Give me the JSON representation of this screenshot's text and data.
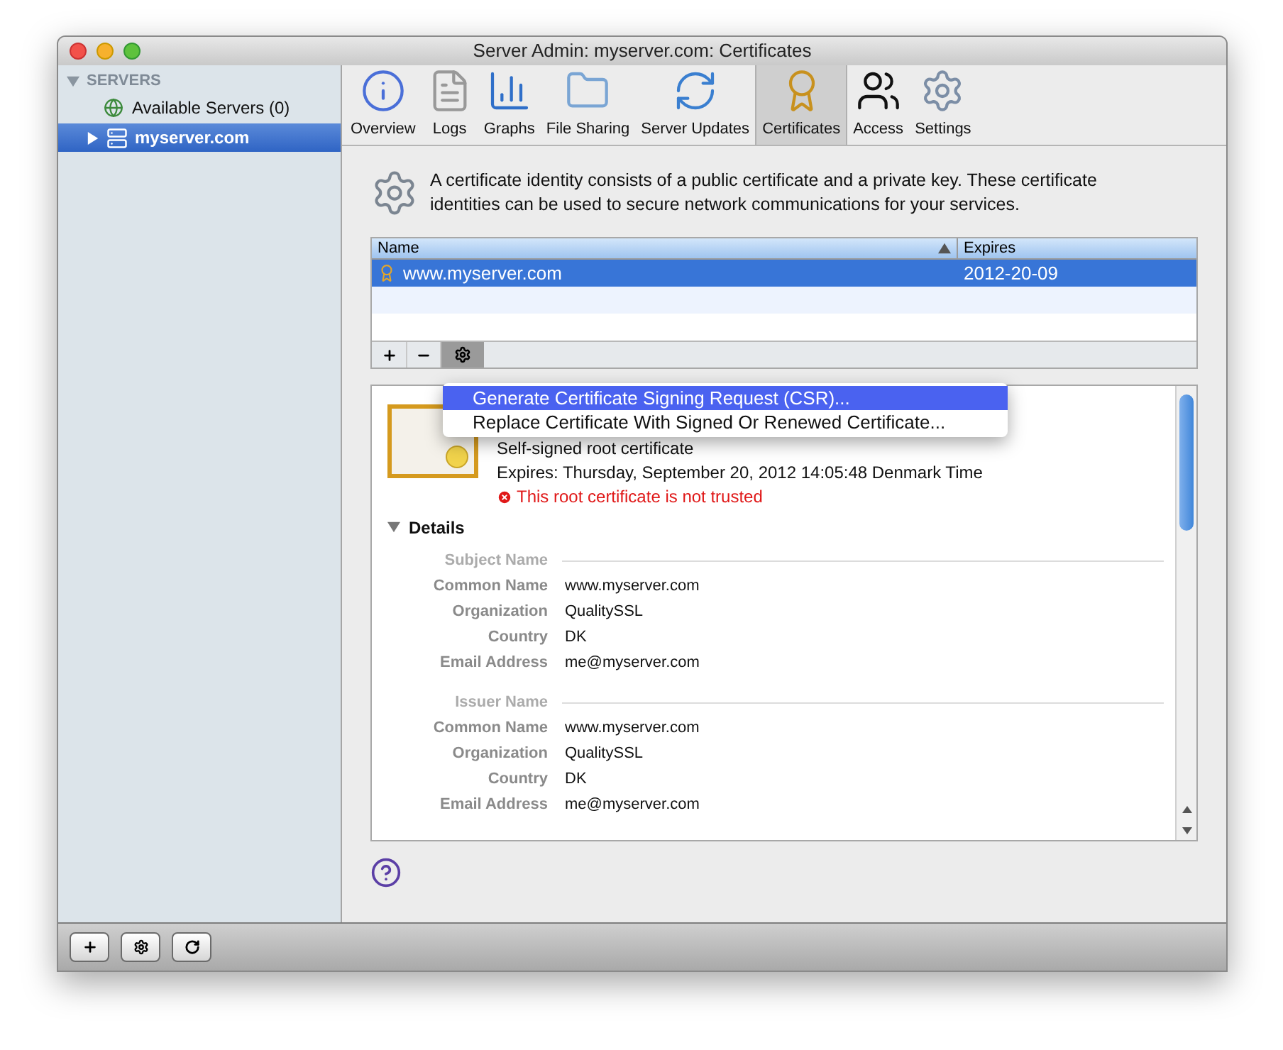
{
  "window": {
    "title": "Server Admin: myserver.com: Certificates"
  },
  "sidebar": {
    "header": "SERVERS",
    "expanded": true,
    "items": [
      {
        "label": "Available Servers (0)",
        "kind": "group",
        "selected": false
      },
      {
        "label": "myserver.com",
        "kind": "server",
        "selected": true
      }
    ]
  },
  "toolbar": [
    {
      "label": "Overview",
      "selected": false
    },
    {
      "label": "Logs",
      "selected": false
    },
    {
      "label": "Graphs",
      "selected": false
    },
    {
      "label": "File Sharing",
      "selected": false
    },
    {
      "label": "Server Updates",
      "selected": false
    },
    {
      "label": "Certificates",
      "selected": true
    },
    {
      "label": "Access",
      "selected": false
    },
    {
      "label": "Settings",
      "selected": false
    }
  ],
  "description": "A certificate identity consists of a public certificate and a private key. These certificate identities can be used to secure network communications for your services.",
  "table": {
    "columns": [
      {
        "label": "Name",
        "sorted": true
      },
      {
        "label": "Expires",
        "sorted": false
      }
    ],
    "rows": [
      {
        "name": "www.myserver.com",
        "expires": "2012-20-09",
        "selected": true
      }
    ]
  },
  "menu": [
    {
      "label": "Generate Certificate Signing Request (CSR)...",
      "selected": true
    },
    {
      "label": "Replace Certificate With Signed Or Renewed Certificate...",
      "selected": false
    }
  ],
  "certificate": {
    "subtitle": "Self-signed root certificate",
    "expires": "Expires: Thursday, September 20, 2012 14:05:48  Denmark Time",
    "warning": "This root certificate is not trusted"
  },
  "details": {
    "label": "Details",
    "expanded": true,
    "sections": [
      {
        "title": "Subject Name",
        "fields": [
          {
            "label": "Common Name",
            "value": "www.myserver.com"
          },
          {
            "label": "Organization",
            "value": "QualitySSL"
          },
          {
            "label": "Country",
            "value": "DK"
          },
          {
            "label": "Email Address",
            "value": "me@myserver.com"
          }
        ]
      },
      {
        "title": "Issuer Name",
        "fields": [
          {
            "label": "Common Name",
            "value": "www.myserver.com"
          },
          {
            "label": "Organization",
            "value": "QualitySSL"
          },
          {
            "label": "Country",
            "value": "DK"
          },
          {
            "label": "Email Address",
            "value": "me@myserver.com"
          }
        ]
      }
    ]
  }
}
